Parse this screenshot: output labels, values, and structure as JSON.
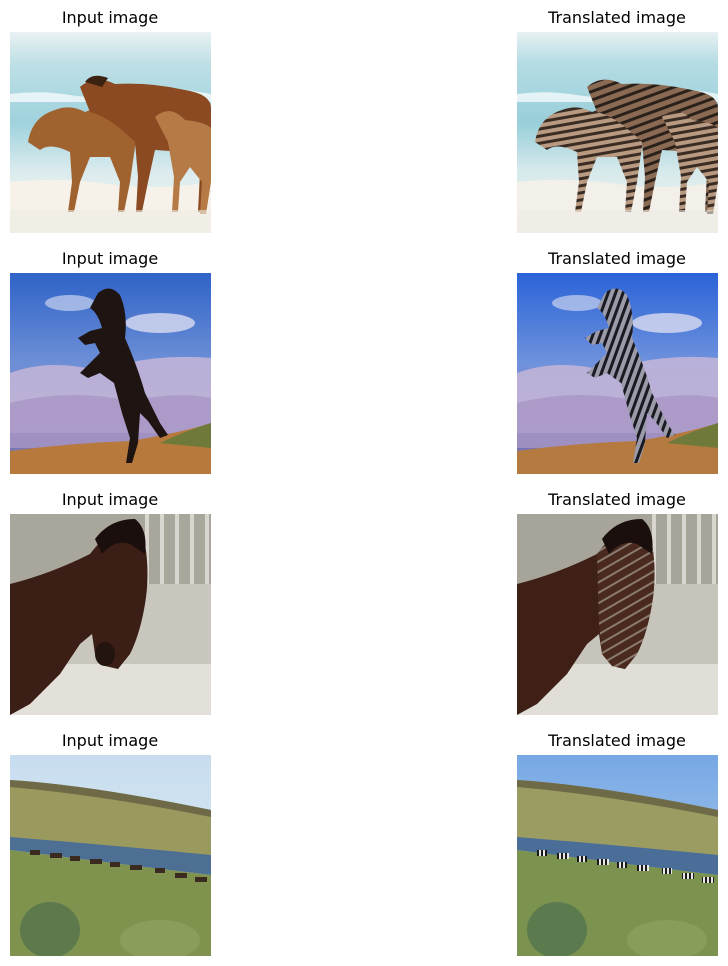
{
  "figure": {
    "rows": [
      {
        "input_title": "Input image",
        "output_title": "Translated image",
        "scene": "horses on a beach",
        "translated_scene": "zebras on a beach"
      },
      {
        "input_title": "Input image",
        "output_title": "Translated image",
        "scene": "rearing horse against a cloudy sky",
        "translated_scene": "rearing zebra against a cloudy sky"
      },
      {
        "input_title": "Input image",
        "output_title": "Translated image",
        "scene": "brown horse close-up in a barn",
        "translated_scene": "striped horse close-up in a barn"
      },
      {
        "input_title": "Input image",
        "output_title": "Translated image",
        "scene": "herd of horses in a grassy valley",
        "translated_scene": "herd of zebras in a grassy valley"
      }
    ]
  }
}
